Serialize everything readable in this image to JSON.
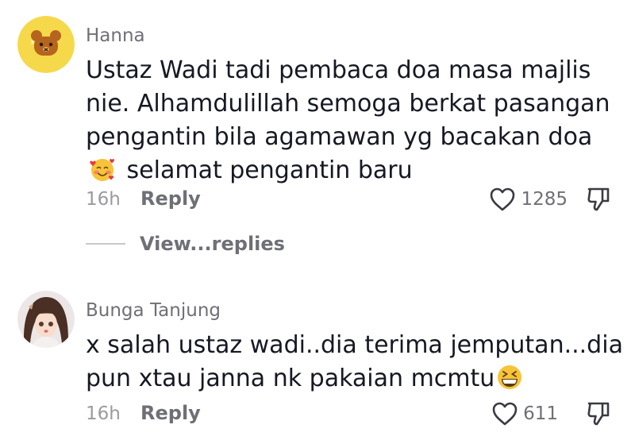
{
  "comments": [
    {
      "username": "Hanna",
      "text_part1": "Ustaz Wadi tadi pembaca doa masa majlis nie. Alhamdulillah semoga berkat pasangan pengantin bila agamawan yg bacakan doa",
      "emoji": "smiling-face-with-hearts",
      "text_part2": "selamat pengantin baru",
      "time": "16h",
      "reply_label": "Reply",
      "likes": "1285",
      "view_replies_label": "View...replies"
    },
    {
      "username": "Bunga Tanjung",
      "text_part1": "x salah ustaz wadi..dia terima jemputan...dia pun xtau janna nk pakaian mcmtu",
      "emoji": "grinning-squinting-face",
      "time": "16h",
      "reply_label": "Reply",
      "likes": "611"
    }
  ],
  "colors": {
    "username": "#6f7076",
    "body_text": "#161823",
    "meta": "#9a9aa0",
    "avatar_bear_bg": "#f6d94a",
    "avatar_bear_face": "#b5651d"
  }
}
